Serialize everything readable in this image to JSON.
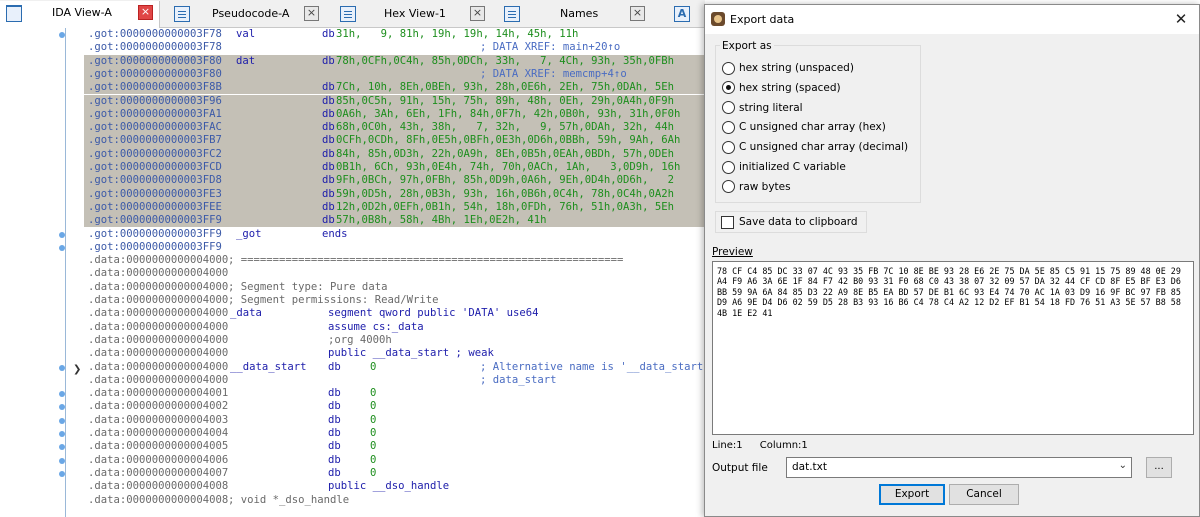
{
  "tabs": {
    "ida_view": "IDA View-A",
    "pseudocode": "Pseudocode-A",
    "hex_view": "Hex View-1",
    "names": "Names",
    "extra_letter": "A",
    "close_glyph": "×"
  },
  "listing": {
    "rows": [
      {
        "addr": ".got:0000000000003F78",
        "name": "val",
        "op": "db",
        "arg": "31h,   9, 81h, 19h, 19h, 14h, 45h, 11h",
        "comment": ""
      },
      {
        "addr": ".got:0000000000003F78",
        "name": "",
        "op": "",
        "arg": "",
        "comment": "; DATA XREF: main+20↑o"
      },
      {
        "addr": ".got:0000000000003F80",
        "name": "dat",
        "op": "db",
        "arg": "78h,0CFh,0C4h, 85h,0DCh, 33h,   7, 4Ch, 93h, 35h,0FBh",
        "comment": ""
      },
      {
        "addr": ".got:0000000000003F80",
        "name": "",
        "op": "",
        "arg": "",
        "comment": "; DATA XREF: memcmp+4↑o"
      },
      {
        "addr": ".got:0000000000003F8B",
        "name": "",
        "op": "db",
        "arg": "7Ch, 10h, 8Eh,0BEh, 93h, 28h,0E6h, 2Eh, 75h,0DAh, 5Eh",
        "comment": ""
      },
      {
        "addr": ".got:0000000000003F96",
        "name": "",
        "op": "db",
        "arg": "85h,0C5h, 91h, 15h, 75h, 89h, 48h, 0Eh, 29h,0A4h,0F9h",
        "comment": ""
      },
      {
        "addr": ".got:0000000000003FA1",
        "name": "",
        "op": "db",
        "arg": "0A6h, 3Ah, 6Eh, 1Fh, 84h,0F7h, 42h,0B0h, 93h, 31h,0F0h",
        "comment": ""
      },
      {
        "addr": ".got:0000000000003FAC",
        "name": "",
        "op": "db",
        "arg": "68h,0C0h, 43h, 38h,   7, 32h,   9, 57h,0DAh, 32h, 44h",
        "comment": ""
      },
      {
        "addr": ".got:0000000000003FB7",
        "name": "",
        "op": "db",
        "arg": "0CFh,0CDh, 8Fh,0E5h,0BFh,0E3h,0D6h,0BBh, 59h, 9Ah, 6Ah",
        "comment": ""
      },
      {
        "addr": ".got:0000000000003FC2",
        "name": "",
        "op": "db",
        "arg": "84h, 85h,0D3h, 22h,0A9h, 8Eh,0B5h,0EAh,0BDh, 57h,0DEh",
        "comment": ""
      },
      {
        "addr": ".got:0000000000003FCD",
        "name": "",
        "op": "db",
        "arg": "0B1h, 6Ch, 93h,0E4h, 74h, 70h,0ACh, 1Ah,   3,0D9h, 16h",
        "comment": ""
      },
      {
        "addr": ".got:0000000000003FD8",
        "name": "",
        "op": "db",
        "arg": "9Fh,0BCh, 97h,0FBh, 85h,0D9h,0A6h, 9Eh,0D4h,0D6h,   2",
        "comment": ""
      },
      {
        "addr": ".got:0000000000003FE3",
        "name": "",
        "op": "db",
        "arg": "59h,0D5h, 28h,0B3h, 93h, 16h,0B6h,0C4h, 78h,0C4h,0A2h",
        "comment": ""
      },
      {
        "addr": ".got:0000000000003FEE",
        "name": "",
        "op": "db",
        "arg": "12h,0D2h,0EFh,0B1h, 54h, 18h,0FDh, 76h, 51h,0A3h, 5Eh",
        "comment": ""
      },
      {
        "addr": ".got:0000000000003FF9",
        "name": "",
        "op": "db",
        "arg": "57h,0B8h, 58h, 4Bh, 1Eh,0E2h, 41h",
        "comment": ""
      },
      {
        "addr": ".got:0000000000003FF9",
        "name": "_got",
        "op": "ends",
        "arg": "",
        "comment": ""
      },
      {
        "addr": ".got:0000000000003FF9",
        "name": "",
        "op": "",
        "arg": "",
        "comment": ""
      },
      {
        "addr": ".data:0000000000004000",
        "name": "",
        "op": "",
        "arg": "",
        "comment": "",
        "grey": "; ============================================================"
      },
      {
        "addr": ".data:0000000000004000",
        "name": "",
        "op": "",
        "arg": "",
        "comment": ""
      },
      {
        "addr": ".data:0000000000004000",
        "name": "",
        "op": "",
        "arg": "",
        "comment": "",
        "grey": "; Segment type: Pure data"
      },
      {
        "addr": ".data:0000000000004000",
        "name": "",
        "op": "",
        "arg": "",
        "comment": "",
        "grey": "; Segment permissions: Read/Write"
      },
      {
        "addr": ".data:0000000000004000",
        "name": "_data",
        "op": "",
        "arg": "",
        "comment": "",
        "seg": "segment qword public 'DATA' use64"
      },
      {
        "addr": ".data:0000000000004000",
        "name": "",
        "op": "",
        "arg": "",
        "comment": "",
        "seg": "assume cs:_data"
      },
      {
        "addr": ".data:0000000000004000",
        "name": "",
        "op": "",
        "arg": "",
        "comment": "",
        "seggrey": ";org 4000h"
      },
      {
        "addr": ".data:0000000000004000",
        "name": "",
        "op": "",
        "arg": "",
        "comment": "",
        "seg": "public __data_start ; weak"
      },
      {
        "addr": ".data:0000000000004000",
        "name": "__data_start",
        "op": "db",
        "arg": "0",
        "comment": "; Alternative name is '__data_start'"
      },
      {
        "addr": ".data:0000000000004000",
        "name": "",
        "op": "",
        "arg": "",
        "comment": "; data_start"
      },
      {
        "addr": ".data:0000000000004001",
        "name": "",
        "op": "db",
        "arg": "0",
        "comment": ""
      },
      {
        "addr": ".data:0000000000004002",
        "name": "",
        "op": "db",
        "arg": "0",
        "comment": ""
      },
      {
        "addr": ".data:0000000000004003",
        "name": "",
        "op": "db",
        "arg": "0",
        "comment": ""
      },
      {
        "addr": ".data:0000000000004004",
        "name": "",
        "op": "db",
        "arg": "0",
        "comment": ""
      },
      {
        "addr": ".data:0000000000004005",
        "name": "",
        "op": "db",
        "arg": "0",
        "comment": ""
      },
      {
        "addr": ".data:0000000000004006",
        "name": "",
        "op": "db",
        "arg": "0",
        "comment": ""
      },
      {
        "addr": ".data:0000000000004007",
        "name": "",
        "op": "db",
        "arg": "0",
        "comment": ""
      },
      {
        "addr": ".data:0000000000004008",
        "name": "",
        "op": "",
        "arg": "",
        "comment": "",
        "seg": "public __dso_handle"
      },
      {
        "addr": ".data:0000000000004008",
        "name": "",
        "op": "",
        "arg": "",
        "comment": "",
        "grey": "; void *_dso_handle"
      }
    ]
  },
  "dialog": {
    "title": "Export data",
    "close": "✕",
    "export_as_label": "Export as",
    "options": [
      {
        "label": "hex string (unspaced)",
        "selected": false
      },
      {
        "label": "hex string (spaced)",
        "selected": true
      },
      {
        "label": "string literal",
        "selected": false
      },
      {
        "label": "C unsigned char array (hex)",
        "selected": false
      },
      {
        "label": "C unsigned char array (decimal)",
        "selected": false
      },
      {
        "label": "initialized C variable",
        "selected": false
      },
      {
        "label": "raw bytes",
        "selected": false
      }
    ],
    "clipboard_label": "Save data to clipboard",
    "clipboard_checked": false,
    "preview_label": "Preview",
    "preview_text": "78 CF C4 85 DC 33 07 4C 93 35 FB 7C 10 8E BE 93 28 E6 2E 75 DA 5E 85 C5 91 15 75 89 48 0E 29 A4 F9 A6 3A 6E 1F 84 F7 42 B0 93 31 F0 68 C0 43 38 07 32 09 57 DA 32 44 CF CD 8F E5 BF E3 D6 BB 59 9A 6A 84 85 D3 22 A9 8E B5 EA BD 57 DE B1 6C 93 E4 74 70 AC 1A 03 D9 16 9F BC 97 FB 85 D9 A6 9E D4 D6 02 59 D5 28 B3 93 16 B6 C4 78 C4 A2 12 D2 EF B1 54 18 FD 76 51 A3 5E 57 B8 58 4B 1E E2 41",
    "line_text": "Line:1",
    "column_text": "Column:1",
    "output_label": "Output file",
    "output_value": "dat.txt",
    "browse_label": "...",
    "export_button": "Export",
    "cancel_button": "Cancel"
  },
  "colors": {
    "selection": "#c4c0b6",
    "accent": "#0078d7"
  }
}
